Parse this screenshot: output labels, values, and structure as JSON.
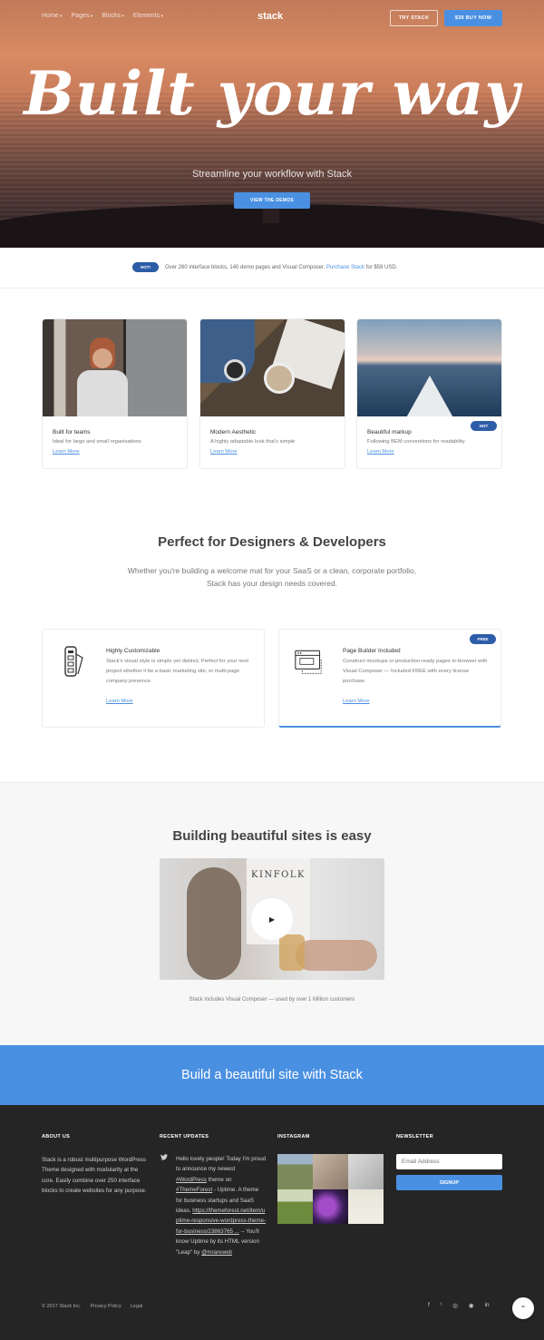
{
  "nav": {
    "items": [
      "Home",
      "Pages",
      "Blocks",
      "Elements"
    ],
    "logo": "stack",
    "try_label": "TRY STACK",
    "buy_label": "$39 BUY NOW"
  },
  "hero": {
    "headline": "Built your way",
    "subtitle": "Streamline your workflow with Stack",
    "cta_label": "VIEW THE DEMOS"
  },
  "notice": {
    "badge": "HOT!",
    "text": "Over 260 interface blocks, 140 demo pages and Visual Composer.",
    "link": "Purchase Stack",
    "suffix": "for $59 USD."
  },
  "cards": [
    {
      "title": "Built for teams",
      "desc": "Ideal for large and small organisations",
      "more": "Learn More"
    },
    {
      "title": "Modern Aesthetic",
      "desc": "A highly adaptable look that's simple",
      "more": "Learn More"
    },
    {
      "title": "Beautiful markup",
      "desc": "Following BEM conventions for readability",
      "more": "Learn More",
      "badge": "HOT"
    }
  ],
  "section2": {
    "title": "Perfect for Designers & Developers",
    "subtitle": "Whether you're building a welcome mat for your SaaS or a clean, corporate portfolio, Stack has your design needs covered."
  },
  "features": [
    {
      "title": "Highly Customizable",
      "desc": "Stack's visual style is simple yet distinct. Perfect for your next project whether it be a basic marketing site, or multi-page company presence.",
      "more": "Learn More",
      "icon": "swatch-icon"
    },
    {
      "title": "Page Builder Included",
      "desc": "Construct mockups or production-ready pages in-browser with Visual Composer — Included FREE with every license purchase.",
      "more": "Learn More",
      "badge": "FREE",
      "icon": "browser-window-icon"
    }
  ],
  "section3": {
    "title": "Building beautiful sites is easy",
    "magazine": "KINFOLK",
    "caption": "Stack includes Visual Composer — used by over 1 Million customers"
  },
  "cta": {
    "text": "Build a beautiful site with Stack"
  },
  "footer": {
    "about_title": "ABOUT US",
    "about_text": "Stack is a robust multipurpose WordPress Theme designed with modularity at the core. Easily combine over 250 interface blocks to create websites for any purpose.",
    "updates_title": "RECENT UPDATES",
    "tweet_part1": "Hello lovely people! Today I'm proud to announce my newest",
    "tweet_tag1": "#WordPress",
    "tweet_part2": "theme on",
    "tweet_tag2": "#ThemeForest",
    "tweet_part3": "- Uptime. A theme for business startups and SaaS ideas.",
    "tweet_link": "https://themeforest.net/item/uptime-responsive-wordpress-theme-for-business/23863765 ...",
    "tweet_part4": "-- You'll know Uptime by its HTML version \"Leap\" by",
    "tweet_handle": "@mrareweb",
    "instagram_title": "INSTAGRAM",
    "newsletter_title": "NEWSLETTER",
    "email_placeholder": "Email Address",
    "signup_label": "SIGNUP",
    "copyright": "© 2017 Stack Inc.",
    "privacy": "Privacy Policy",
    "legal": "Legal",
    "social": [
      "f",
      "t",
      "instagram",
      "dribbble",
      "in"
    ]
  },
  "colors": {
    "accent": "#4a90e2",
    "badge": "#2e5da8",
    "footer_bg": "#252525"
  }
}
